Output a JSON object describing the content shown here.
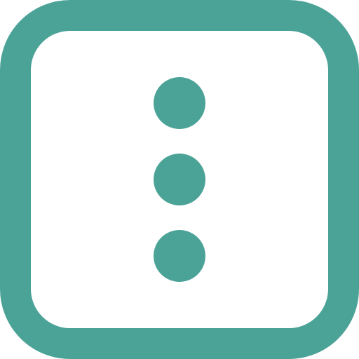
{
  "icon": {
    "name": "vertical-ellipsis-square-icon",
    "color": "#4ba398",
    "background": "#ffffff"
  }
}
